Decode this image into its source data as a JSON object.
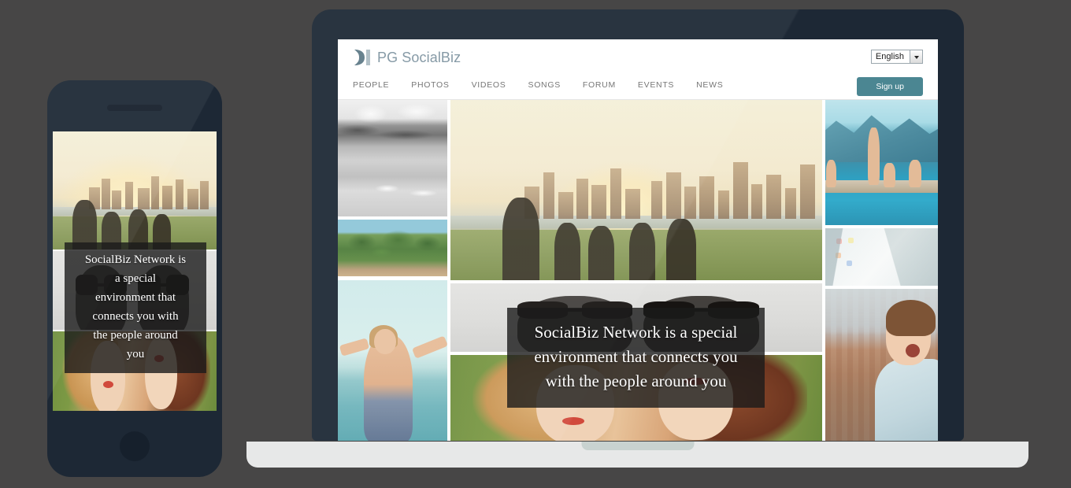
{
  "page": {
    "background_color": "#474646"
  },
  "devices": {
    "phone": {
      "name": "phone-mockup",
      "body_color": "#1d2835"
    },
    "laptop": {
      "name": "laptop-mockup",
      "body_color": "#1d2835",
      "base_color": "#e7e8e8"
    }
  },
  "site": {
    "brand": {
      "name": "PG SocialBiz",
      "logo_icon": "crescent-bar-logo-icon",
      "text_color": "#7f94a1"
    },
    "language_selector": {
      "value": "English",
      "arrow_icon": "chevron-down-icon",
      "options": [
        "English"
      ]
    },
    "signup_button": {
      "label": "Sign up",
      "color": "#4b8692"
    },
    "nav": {
      "items": [
        {
          "label": "PEOPLE"
        },
        {
          "label": "PHOTOS"
        },
        {
          "label": "VIDEOS"
        },
        {
          "label": "SONGS"
        },
        {
          "label": "FORUM"
        },
        {
          "label": "EVENTS"
        },
        {
          "label": "NEWS"
        }
      ]
    },
    "hero": {
      "lines": [
        "SocialBiz Network is a special",
        "environment that connects you",
        "with the people around you"
      ],
      "overlay_color": "rgba(26,26,26,0.80)",
      "text_color": "#ffffff"
    },
    "hero_mobile": {
      "lines": [
        "SocialBiz Network is",
        "a special",
        "environment that",
        "connects you with",
        "the people around",
        "you"
      ]
    },
    "gallery": {
      "tiles": [
        {
          "id": "left-top",
          "alt": "black and white beach landscape"
        },
        {
          "id": "left-mid",
          "alt": "green field with trees"
        },
        {
          "id": "left-bottom",
          "alt": "woman with outstretched arms at the beach"
        },
        {
          "id": "center-top",
          "alt": "friends on grass at sunset with city skyline"
        },
        {
          "id": "center-mid",
          "alt": "two pairs of sunglasses on light background"
        },
        {
          "id": "center-bottom",
          "alt": "two young women lying on grass"
        },
        {
          "id": "right-top",
          "alt": "people by a pool with blue mountains"
        },
        {
          "id": "right-mid",
          "alt": "pale concrete skate ramp"
        },
        {
          "id": "right-bottom",
          "alt": "smiling woman on a rooftop"
        }
      ]
    },
    "mobile_gallery": {
      "tiles": [
        {
          "id": "m-top",
          "alt": "friends on grass at sunset with city skyline"
        },
        {
          "id": "m-mid",
          "alt": "two pairs of sunglasses on light background"
        },
        {
          "id": "m-bottom",
          "alt": "two young women lying on grass"
        }
      ]
    }
  }
}
